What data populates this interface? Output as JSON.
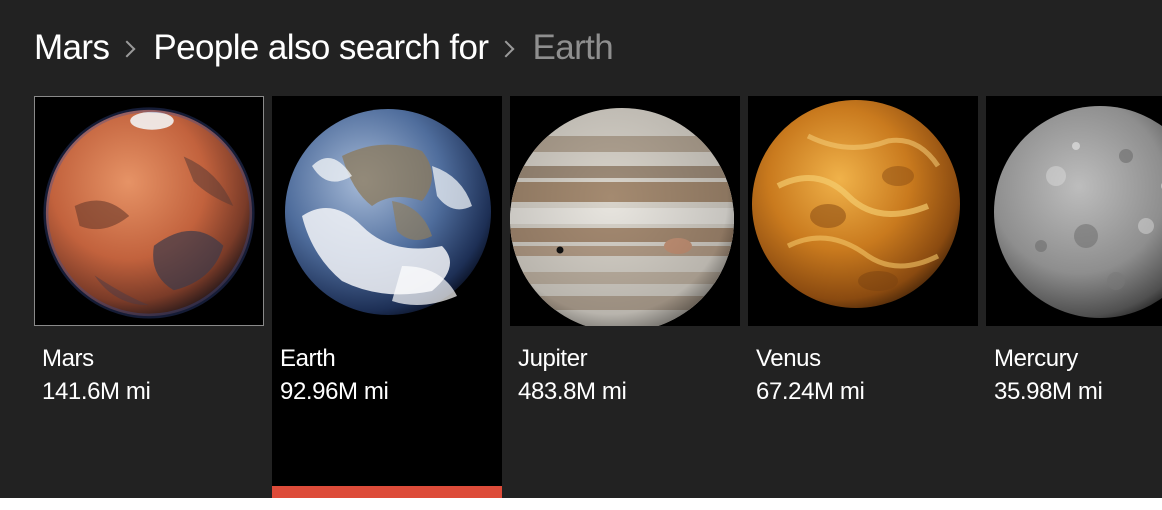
{
  "breadcrumb": {
    "root": "Mars",
    "middle": "People also search for",
    "current": "Earth"
  },
  "cards": [
    {
      "name": "Mars",
      "distance": "141.6M mi",
      "image": "mars-image"
    },
    {
      "name": "Earth",
      "distance": "92.96M mi",
      "image": "earth-image"
    },
    {
      "name": "Jupiter",
      "distance": "483.8M mi",
      "image": "jupiter-image"
    },
    {
      "name": "Venus",
      "distance": "67.24M mi",
      "image": "venus-image"
    },
    {
      "name": "Mercury",
      "distance": "35.98M mi",
      "image": "mercury-image"
    }
  ],
  "selected_index": 1,
  "colors": {
    "panel_background": "#222222",
    "selected_background": "#000000",
    "selected_indicator": "#dd4b39",
    "text_primary": "#ffffff",
    "text_muted": "#8f8f8f"
  }
}
